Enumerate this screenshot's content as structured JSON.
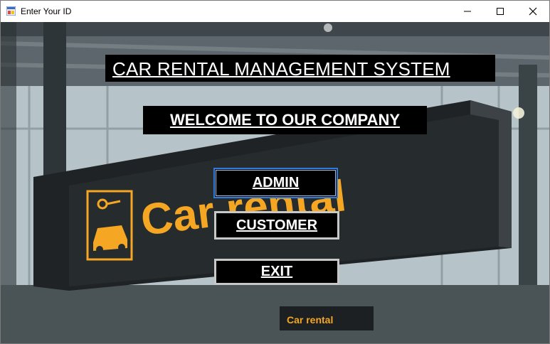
{
  "window": {
    "title": "Enter Your ID",
    "controls": {
      "minimize": "—",
      "maximize": "☐",
      "close": "✕"
    }
  },
  "background": {
    "sign_text": "Car rental",
    "small_sign_text": "Car rental",
    "sign_color": "#f5a623"
  },
  "header": {
    "title": "CAR RENTAL MANAGEMENT SYSTEM",
    "welcome": "WELCOME TO OUR COMPANY"
  },
  "buttons": {
    "admin": "ADMIN",
    "customer": "CUSTOMER",
    "exit": "EXIT"
  }
}
